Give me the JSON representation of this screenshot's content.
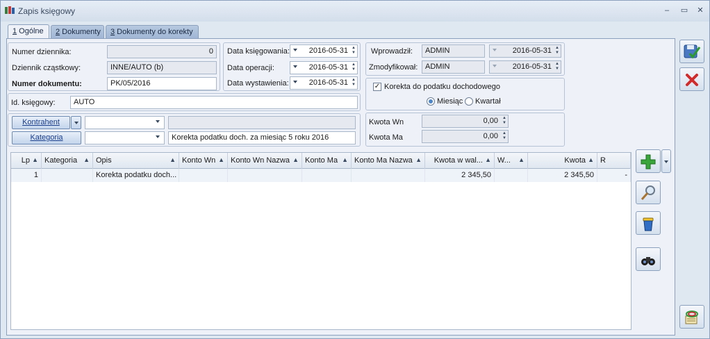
{
  "window": {
    "title": "Zapis księgowy"
  },
  "tabs": [
    {
      "num": "1",
      "label": " Ogólne"
    },
    {
      "num": "2",
      "label": " Dokumenty"
    },
    {
      "num": "3",
      "label": " Dokumenty do korekty"
    }
  ],
  "form": {
    "numer_dziennika_label": "Numer dziennika:",
    "numer_dziennika_value": "0",
    "dziennik_czastkowy_label": "Dziennik cząstkowy:",
    "dziennik_czastkowy_value": "INNE/AUTO (b)",
    "numer_dokumentu_label": "Numer dokumentu:",
    "numer_dokumentu_value": "PK/05/2016",
    "id_ksiegowy_label": "Id. księgowy:",
    "id_ksiegowy_value": "AUTO",
    "data_ksiegowania_label": "Data księgowania:",
    "data_ksiegowania_value": "2016-05-31",
    "data_operacji_label": "Data operacji:",
    "data_operacji_value": "2016-05-31",
    "data_wystawienia_label": "Data wystawienia:",
    "data_wystawienia_value": "2016-05-31",
    "kontrahent_label": "Kontrahent",
    "kontrahent_value": "",
    "kontrahent_name": "",
    "kategoria_label": "Kategoria",
    "kategoria_value": "",
    "kategoria_desc": "Korekta podatku doch. za miesiąc 5 roku 2016"
  },
  "audit": {
    "wprowadzil_label": "Wprowadził:",
    "wprowadzil_user": "ADMIN",
    "wprowadzil_date": "2016-05-31",
    "zmodyfikowal_label": "Zmodyfikował:",
    "zmodyfikowal_user": "ADMIN",
    "zmodyfikowal_date": "2016-05-31"
  },
  "korekta": {
    "checkbox_label": "Korekta do podatku dochodowego",
    "checked": true,
    "period_month_label": "Miesiąc",
    "period_quarter_label": "Kwartał",
    "selected": "Miesiąc"
  },
  "kwoty": {
    "wn_label": "Kwota Wn",
    "wn_value": "0,00",
    "ma_label": "Kwota Ma",
    "ma_value": "0,00"
  },
  "grid": {
    "columns": [
      "Lp",
      "Kategoria",
      "Opis",
      "Konto Wn",
      "Konto Wn Nazwa",
      "Konto Ma",
      "Konto Ma Nazwa",
      "Kwota w wal...",
      "W...",
      "Kwota",
      "R"
    ],
    "rows": [
      {
        "lp": "1",
        "kategoria": "",
        "opis": "Korekta podatku doch...",
        "konto_wn": "",
        "konto_wn_nazwa": "",
        "konto_ma": "",
        "konto_ma_nazwa": "",
        "kwota_wal": "2 345,50",
        "waluta": "",
        "kwota": "2 345,50",
        "r": "-"
      }
    ]
  },
  "icons": {
    "save": "save-icon",
    "cancel": "cancel-icon",
    "add": "add-icon",
    "view": "magnifier-icon",
    "delete": "trash-icon",
    "find": "binoculars-icon",
    "export": "export-icon"
  }
}
